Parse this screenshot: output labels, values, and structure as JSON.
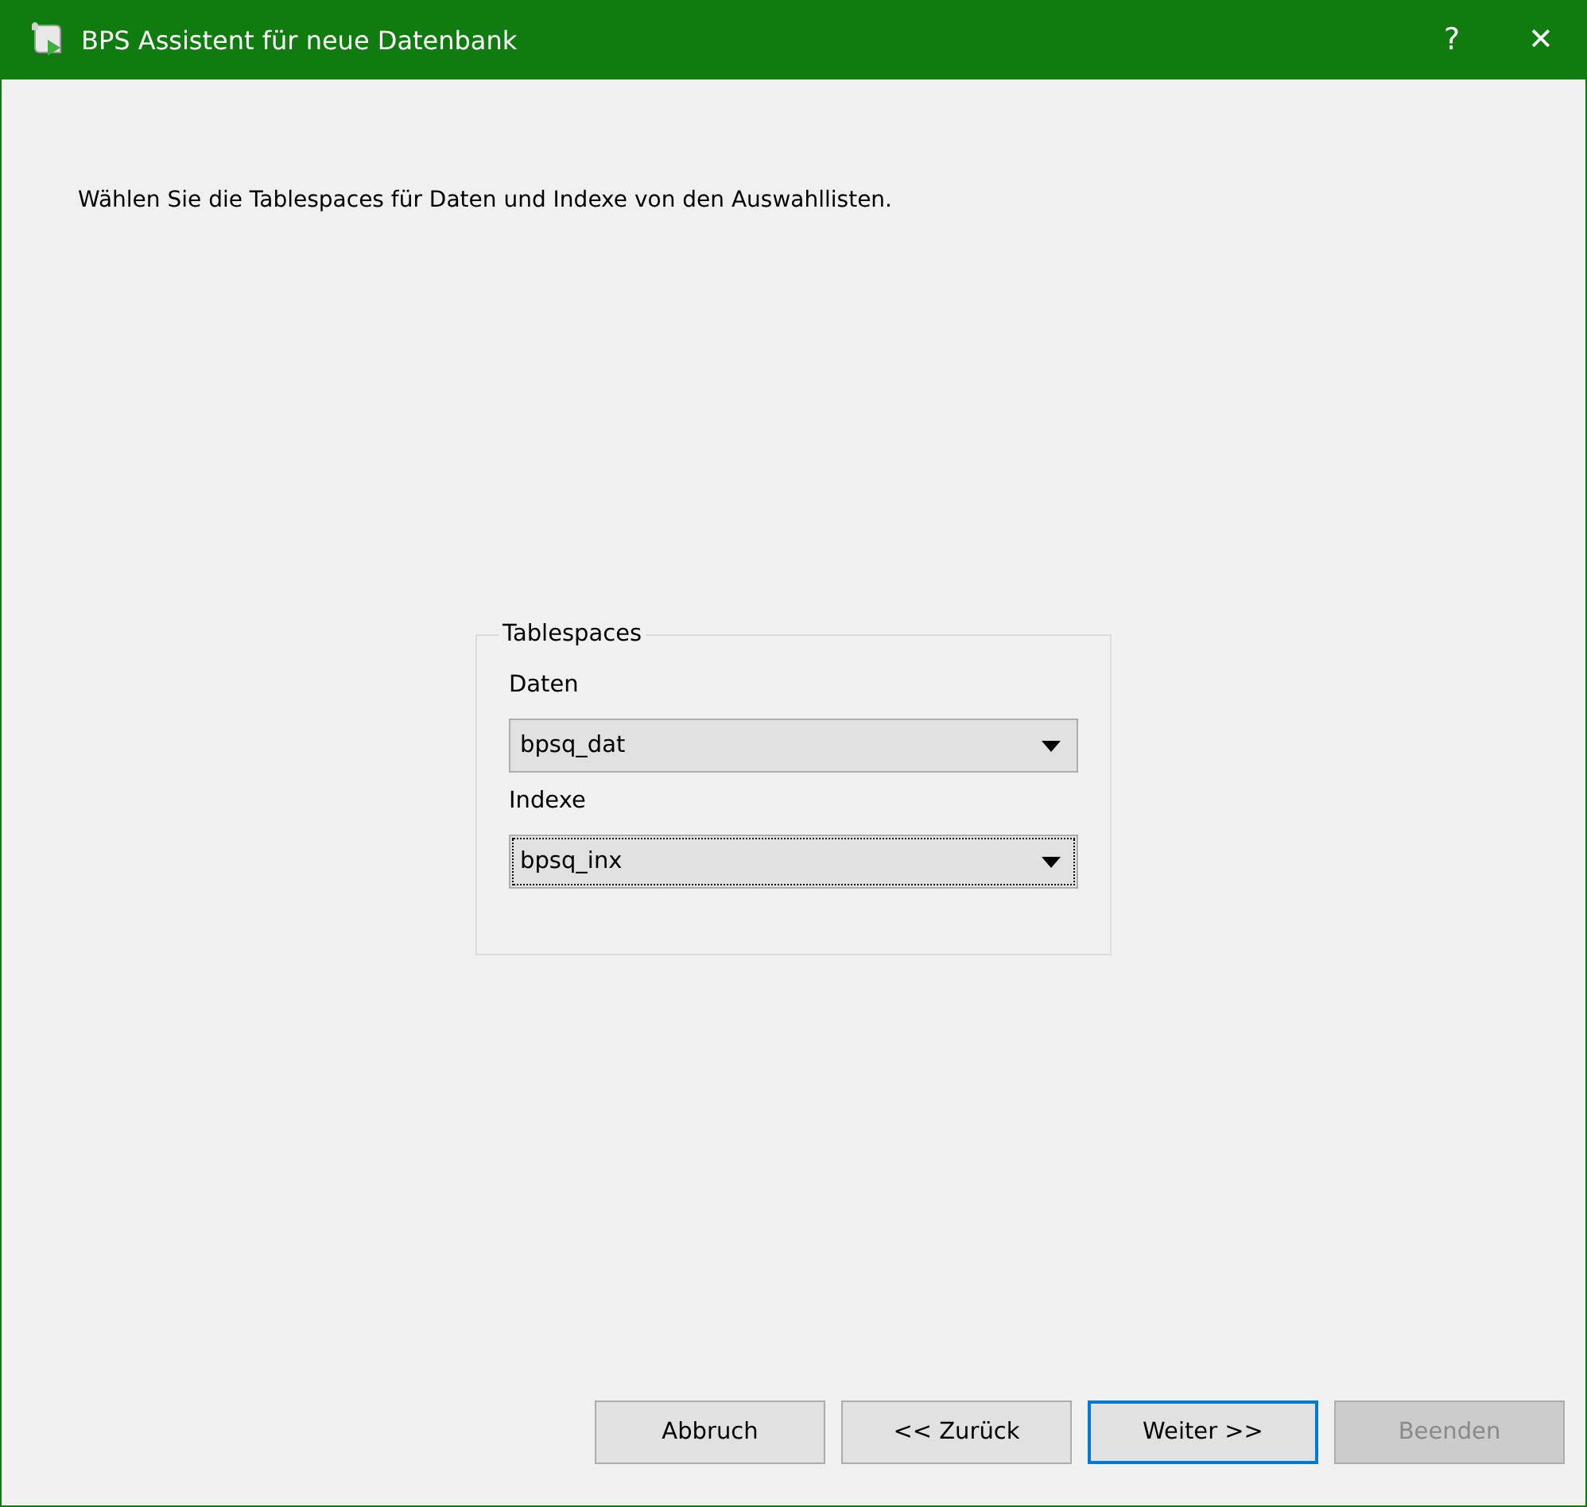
{
  "window": {
    "title": "BPS Assistent für neue Datenbank",
    "help": "?",
    "close": "✕"
  },
  "instruction": "Wählen Sie die Tablespaces für Daten und Indexe von den Auswahllisten.",
  "group": {
    "title": "Tablespaces",
    "fields": [
      {
        "label": "Daten",
        "value": "bpsq_dat",
        "focused": false
      },
      {
        "label": "Indexe",
        "value": "bpsq_inx",
        "focused": true
      }
    ]
  },
  "buttons": [
    {
      "label": "Abbruch",
      "default": false,
      "disabled": false
    },
    {
      "label": "<< Zurück",
      "default": false,
      "disabled": false
    },
    {
      "label": "Weiter >>",
      "default": true,
      "disabled": false
    },
    {
      "label": "Beenden",
      "default": false,
      "disabled": true
    }
  ]
}
